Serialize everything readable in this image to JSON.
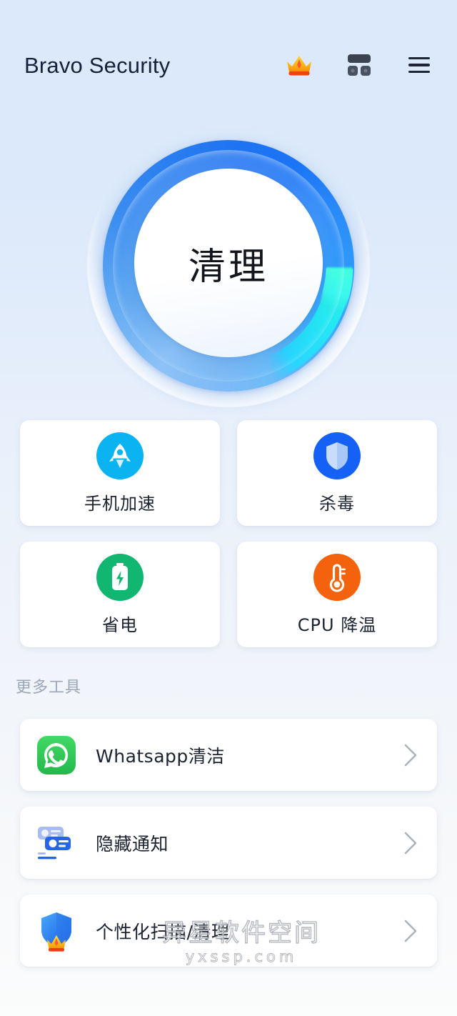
{
  "header": {
    "title": "Bravo Security",
    "icons": [
      {
        "name": "crown-icon",
        "label": "Premium"
      },
      {
        "name": "dashboard-grid-icon",
        "label": "Dashboard"
      },
      {
        "name": "hamburger-menu-icon",
        "label": "Menu"
      }
    ]
  },
  "hero": {
    "button_label": "清理",
    "ring_base_color": "#2a7ef0",
    "ring_light_color": "#7cb9f5",
    "accent_color": "#2ff0d8",
    "core_color": "#ffffff"
  },
  "quick_actions": [
    {
      "label": "手机加速",
      "icon": "rocket-icon",
      "badge_color": "#0bb4f0"
    },
    {
      "label": "杀毒",
      "icon": "shield-icon",
      "badge_color": "#1560f5"
    },
    {
      "label": "省电",
      "icon": "battery-bolt-icon",
      "badge_color": "#11b671"
    },
    {
      "label": "CPU 降温",
      "icon": "thermometer-icon",
      "badge_color": "#f4620d"
    }
  ],
  "more_tools": {
    "heading": "更多工具",
    "items": [
      {
        "label": "Whatsapp清洁",
        "icon": "whatsapp-icon",
        "icon_color": "#2dc653",
        "chevron": "chevron-right-icon"
      },
      {
        "label": "隐藏通知",
        "icon": "hide-notifications-icon",
        "icon_color": "#2563eb",
        "chevron": "chevron-right-icon"
      },
      {
        "label": "个性化扫描/清理",
        "icon": "shield-crown-icon",
        "icon_color": "#2b8ef5",
        "chevron": "chevron-right-icon"
      }
    ]
  },
  "watermark": {
    "line1": "异星软件空间",
    "line2": "yxssp.com"
  }
}
